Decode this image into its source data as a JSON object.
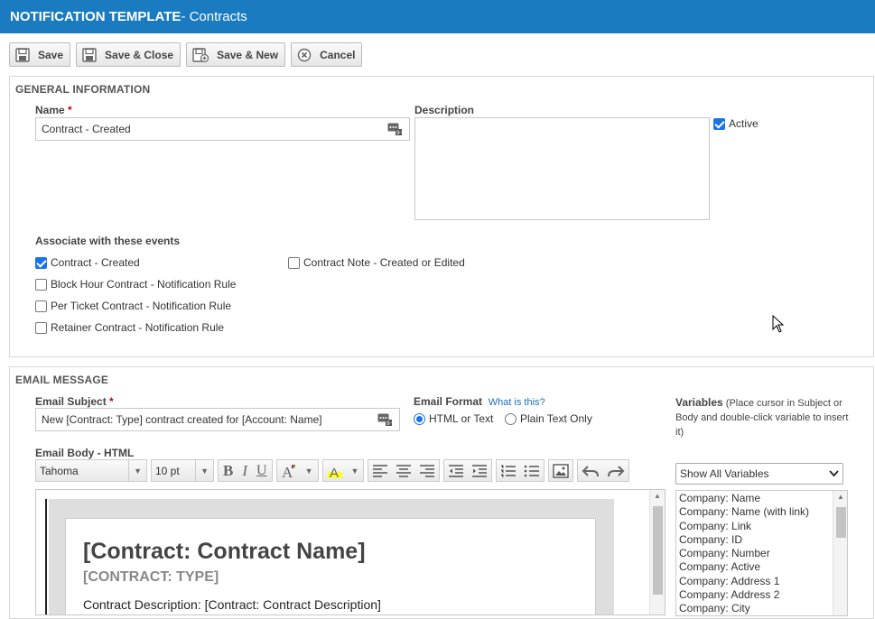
{
  "title": {
    "prefix": "NOTIFICATION TEMPLATE",
    "suffix": " - Contracts"
  },
  "toolbar": {
    "save_label": "Save",
    "save_close_label": "Save & Close",
    "save_new_label": "Save & New",
    "cancel_label": "Cancel"
  },
  "general": {
    "section_title": "GENERAL INFORMATION",
    "name_label": "Name",
    "required_mark": "*",
    "name_value": "Contract - Created",
    "description_label": "Description",
    "description_value": "",
    "active_label": "Active",
    "active_checked": true,
    "events_label": "Associate with these events",
    "events": [
      {
        "label": "Contract - Created",
        "checked": true
      },
      {
        "label": "Block Hour Contract - Notification Rule",
        "checked": false
      },
      {
        "label": "Per Ticket Contract - Notification Rule",
        "checked": false
      },
      {
        "label": "Retainer Contract - Notification Rule",
        "checked": false
      },
      {
        "label": "Contract Note - Created or Edited",
        "checked": false
      }
    ]
  },
  "email": {
    "section_title": "EMAIL MESSAGE",
    "subject_label": "Email Subject",
    "required_mark": "*",
    "subject_value": "New [Contract: Type] contract created for [Account: Name]",
    "format_label": "Email Format",
    "format_help_link": "What is this?",
    "format_options": [
      {
        "label": "HTML or Text",
        "selected": true
      },
      {
        "label": "Plain Text Only",
        "selected": false
      }
    ],
    "body_label": "Email Body - HTML",
    "font_family": "Tahoma",
    "font_size": "10 pt",
    "body_heading": "[Contract: Contract Name]",
    "body_subheading": "[CONTRACT: TYPE]",
    "body_text": "Contract Description: [Contract: Contract Description]"
  },
  "variables": {
    "label": "Variables",
    "hint": "(Place cursor in Subject or Body and double-click variable to insert it)",
    "filter_value": "Show All Variables",
    "items": [
      "Company: Name",
      "Company: Name (with link)",
      "Company: Link",
      "Company: ID",
      "Company: Number",
      "Company: Active",
      "Company: Address 1",
      "Company: Address 2",
      "Company: City"
    ]
  },
  "colors": {
    "titlebar": "#1a7bc0",
    "checkbox_accent": "#1a73e8",
    "required": "#cc0000"
  }
}
